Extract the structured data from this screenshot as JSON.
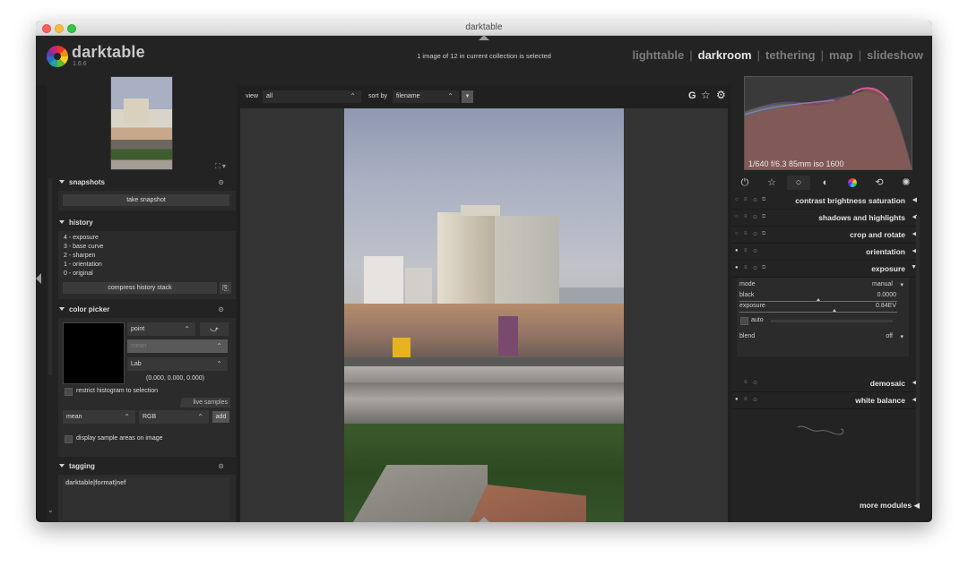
{
  "window": {
    "title": "darktable"
  },
  "app": {
    "name": "darktable",
    "version": "1.6.6"
  },
  "status": "1 image of 12 in current collection is selected",
  "views": [
    {
      "label": "lighttable",
      "active": false
    },
    {
      "label": "darkroom",
      "active": true
    },
    {
      "label": "tethering",
      "active": false
    },
    {
      "label": "map",
      "active": false
    },
    {
      "label": "slideshow",
      "active": false
    }
  ],
  "filterbar": {
    "view_label": "view",
    "view_value": "all",
    "sort_label": "sort by",
    "sort_value": "filename",
    "grouping_label": "G"
  },
  "left": {
    "snapshots": {
      "title": "snapshots",
      "take_snapshot": "take snapshot"
    },
    "history": {
      "title": "history",
      "items": [
        "4 - exposure",
        "3 - base curve",
        "2 - sharpen",
        "1 - orientation",
        "0 - original"
      ],
      "compress": "compress history stack"
    },
    "color_picker": {
      "title": "color picker",
      "mode": "point",
      "disabled_select": "mean",
      "colorspace": "Lab",
      "readout": "(0.000, 0.000, 0.000)",
      "restrict": "restrict histogram to selection",
      "live_samples": "live samples",
      "sample_mode": "mean",
      "sample_space": "RGB",
      "add": "add",
      "display_samples": "display sample areas on image"
    },
    "tagging": {
      "title": "tagging",
      "tag": "darktable|format|nef"
    }
  },
  "right": {
    "histogram_info": "1/640 f/6.3 85mm iso 1600",
    "modules": [
      {
        "name": "contrast brightness saturation"
      },
      {
        "name": "shadows and highlights"
      },
      {
        "name": "crop and rotate"
      },
      {
        "name": "orientation"
      },
      {
        "name": "exposure"
      }
    ],
    "exposure": {
      "mode_label": "mode",
      "mode_value": "manual",
      "black_label": "black",
      "black_value": "0.0000",
      "black_level": 0.5,
      "exposure_label": "exposure",
      "exposure_value": "0.84EV",
      "exposure_level": 0.6,
      "auto_label": "auto",
      "blend_label": "blend",
      "blend_value": "off"
    },
    "lower_modules": [
      {
        "name": "demosaic"
      },
      {
        "name": "white balance"
      }
    ],
    "more_modules": "more modules"
  }
}
